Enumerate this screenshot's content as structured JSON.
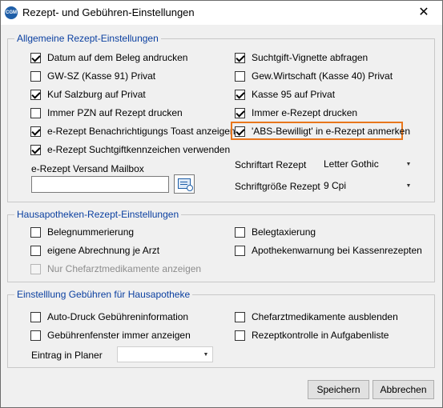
{
  "window": {
    "title": "Rezept- und Gebühren-Einstellungen",
    "icon": "CGM",
    "close": "✕"
  },
  "group_general": {
    "legend": "Allgemeine Rezept-Einstellungen",
    "left": [
      {
        "label": "Datum auf dem Beleg andrucken",
        "checked": true
      },
      {
        "label": "GW-SZ (Kasse 91)  Privat",
        "checked": false
      },
      {
        "label": "Kuf Salzburg auf Privat",
        "checked": true
      },
      {
        "label": "Immer PZN auf Rezept drucken",
        "checked": false
      },
      {
        "label": "e-Rezept Benachrichtigungs Toast anzeigen",
        "checked": true
      },
      {
        "label": "e-Rezept Suchtgiftkennzeichen verwenden",
        "checked": true
      }
    ],
    "right": [
      {
        "label": "Suchtgift-Vignette abfragen",
        "checked": true
      },
      {
        "label": "Gew.Wirtschaft (Kasse 40)  Privat",
        "checked": false
      },
      {
        "label": "Kasse 95 auf Privat",
        "checked": true
      },
      {
        "label": "Immer e-Rezept drucken",
        "checked": true
      },
      {
        "label": "'ABS-Bewilligt' in e-Rezept anmerken",
        "checked": true
      }
    ],
    "mailbox_label": "e-Rezept Versand Mailbox",
    "mailbox_value": "",
    "font_label": "Schriftart Rezept",
    "font_value": "Letter Gothic",
    "size_label": "Schriftgröße Rezept",
    "size_value": "9 Cpi"
  },
  "group_home": {
    "legend": "Hausapotheken-Rezept-Einstellungen",
    "items": [
      {
        "label": "Belegnummerierung",
        "checked": false
      },
      {
        "label": "Belegtaxierung",
        "checked": false
      },
      {
        "label": "eigene Abrechnung je Arzt",
        "checked": false
      },
      {
        "label": "Apothekenwarnung bei Kassenrezepten",
        "checked": false
      },
      {
        "label": "Nur Chefarztmedikamente anzeigen",
        "checked": false,
        "disabled": true
      }
    ]
  },
  "group_fees": {
    "legend": "Einstelllung Gebühren für Hausapotheke",
    "items": [
      {
        "label": "Auto-Druck Gebühreninformation",
        "checked": false
      },
      {
        "label": "Chefarztmedikamente ausblenden",
        "checked": false
      },
      {
        "label": "Gebührenfenster immer anzeigen",
        "checked": false
      },
      {
        "label": "Rezeptkontrolle in Aufgabenliste",
        "checked": false
      }
    ],
    "planner_label": "Eintrag in Planer",
    "planner_value": ""
  },
  "buttons": {
    "save": "Speichern",
    "cancel": "Abbrechen"
  },
  "colors": {
    "legend": "#0a3fa0",
    "highlight": "#e8761c"
  },
  "icons": {
    "dropdown": "▼",
    "mailbox_picker": "address-book-icon"
  }
}
